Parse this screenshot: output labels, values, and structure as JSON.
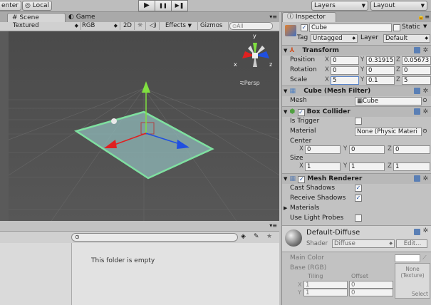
{
  "toolbar": {
    "pivot_label": "enter",
    "space_label": "Local",
    "play_icons": [
      "▶",
      "❚❚",
      "▶❚"
    ],
    "layers_label": "Layers",
    "layout_label": "Layout"
  },
  "scene": {
    "tabs": [
      {
        "label": "Scene"
      },
      {
        "label": "Game"
      }
    ],
    "bar": {
      "render_mode": "Textured",
      "color_mode": "RGB",
      "mode_2d": "2D",
      "effects": "Effects",
      "gizmos": "Gizmos",
      "search_placeholder": "All"
    },
    "gizmo": {
      "y": "y",
      "x": "x",
      "z": "z",
      "persp": "Persp"
    }
  },
  "project": {
    "search_placeholder": "",
    "empty_message": "This folder is empty"
  },
  "inspector": {
    "tab_label": "Inspector",
    "object_name": "Cube",
    "static_label": "Static",
    "tag_label": "Tag",
    "tag_value": "Untagged",
    "layer_label": "Layer",
    "layer_value": "Default",
    "transform": {
      "title": "Transform",
      "position_label": "Position",
      "rotation_label": "Rotation",
      "scale_label": "Scale",
      "axis": [
        "X",
        "Y",
        "Z"
      ],
      "position": [
        "0",
        "0.31915",
        "0.05673"
      ],
      "rotation": [
        "0",
        "0",
        "0"
      ],
      "scale": [
        "5",
        "0.1",
        "5"
      ]
    },
    "mesh_filter": {
      "title": "Cube (Mesh Filter)",
      "mesh_label": "Mesh",
      "mesh_value": "Cube"
    },
    "box_collider": {
      "title": "Box Collider",
      "is_trigger_label": "Is Trigger",
      "material_label": "Material",
      "material_value": "None (Physic Materi",
      "center_label": "Center",
      "center": [
        "0",
        "0",
        "0"
      ],
      "size_label": "Size",
      "size": [
        "1",
        "1",
        "1"
      ]
    },
    "mesh_renderer": {
      "title": "Mesh Renderer",
      "cast_shadows_label": "Cast Shadows",
      "receive_shadows_label": "Receive Shadows",
      "materials_label": "Materials",
      "use_light_probes_label": "Use Light Probes"
    },
    "material": {
      "name": "Default-Diffuse",
      "shader_label": "Shader",
      "shader_value": "Diffuse",
      "edit_label": "Edit...",
      "main_color_label": "Main Color",
      "base_label": "Base (RGB)",
      "tiling_label": "Tiling",
      "offset_label": "Offset",
      "tiling": [
        "1",
        "1"
      ],
      "offset": [
        "0",
        "0"
      ],
      "texture_none": "None",
      "texture_type": "(Texture)",
      "select_label": "Select"
    }
  },
  "colors": {
    "viewport_bg": "#4a4a4a",
    "plane_fill": "#8fb8b8",
    "plane_edge": "#7fe0a0",
    "x_axis": "#e02020",
    "y_axis": "#80e040",
    "z_axis": "#2050e0"
  }
}
